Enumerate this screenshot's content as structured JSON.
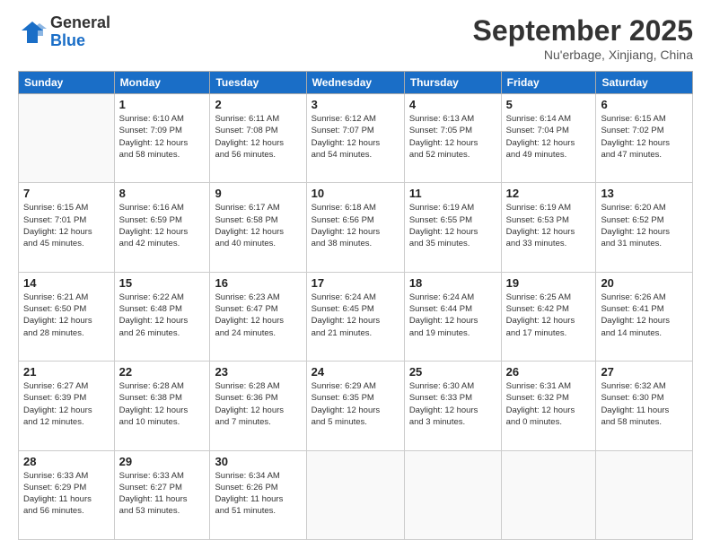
{
  "header": {
    "logo_general": "General",
    "logo_blue": "Blue",
    "month": "September 2025",
    "location": "Nu'erbage, Xinjiang, China"
  },
  "days_of_week": [
    "Sunday",
    "Monday",
    "Tuesday",
    "Wednesday",
    "Thursday",
    "Friday",
    "Saturday"
  ],
  "weeks": [
    [
      {
        "day": "",
        "info": ""
      },
      {
        "day": "1",
        "info": "Sunrise: 6:10 AM\nSunset: 7:09 PM\nDaylight: 12 hours\nand 58 minutes."
      },
      {
        "day": "2",
        "info": "Sunrise: 6:11 AM\nSunset: 7:08 PM\nDaylight: 12 hours\nand 56 minutes."
      },
      {
        "day": "3",
        "info": "Sunrise: 6:12 AM\nSunset: 7:07 PM\nDaylight: 12 hours\nand 54 minutes."
      },
      {
        "day": "4",
        "info": "Sunrise: 6:13 AM\nSunset: 7:05 PM\nDaylight: 12 hours\nand 52 minutes."
      },
      {
        "day": "5",
        "info": "Sunrise: 6:14 AM\nSunset: 7:04 PM\nDaylight: 12 hours\nand 49 minutes."
      },
      {
        "day": "6",
        "info": "Sunrise: 6:15 AM\nSunset: 7:02 PM\nDaylight: 12 hours\nand 47 minutes."
      }
    ],
    [
      {
        "day": "7",
        "info": "Sunrise: 6:15 AM\nSunset: 7:01 PM\nDaylight: 12 hours\nand 45 minutes."
      },
      {
        "day": "8",
        "info": "Sunrise: 6:16 AM\nSunset: 6:59 PM\nDaylight: 12 hours\nand 42 minutes."
      },
      {
        "day": "9",
        "info": "Sunrise: 6:17 AM\nSunset: 6:58 PM\nDaylight: 12 hours\nand 40 minutes."
      },
      {
        "day": "10",
        "info": "Sunrise: 6:18 AM\nSunset: 6:56 PM\nDaylight: 12 hours\nand 38 minutes."
      },
      {
        "day": "11",
        "info": "Sunrise: 6:19 AM\nSunset: 6:55 PM\nDaylight: 12 hours\nand 35 minutes."
      },
      {
        "day": "12",
        "info": "Sunrise: 6:19 AM\nSunset: 6:53 PM\nDaylight: 12 hours\nand 33 minutes."
      },
      {
        "day": "13",
        "info": "Sunrise: 6:20 AM\nSunset: 6:52 PM\nDaylight: 12 hours\nand 31 minutes."
      }
    ],
    [
      {
        "day": "14",
        "info": "Sunrise: 6:21 AM\nSunset: 6:50 PM\nDaylight: 12 hours\nand 28 minutes."
      },
      {
        "day": "15",
        "info": "Sunrise: 6:22 AM\nSunset: 6:48 PM\nDaylight: 12 hours\nand 26 minutes."
      },
      {
        "day": "16",
        "info": "Sunrise: 6:23 AM\nSunset: 6:47 PM\nDaylight: 12 hours\nand 24 minutes."
      },
      {
        "day": "17",
        "info": "Sunrise: 6:24 AM\nSunset: 6:45 PM\nDaylight: 12 hours\nand 21 minutes."
      },
      {
        "day": "18",
        "info": "Sunrise: 6:24 AM\nSunset: 6:44 PM\nDaylight: 12 hours\nand 19 minutes."
      },
      {
        "day": "19",
        "info": "Sunrise: 6:25 AM\nSunset: 6:42 PM\nDaylight: 12 hours\nand 17 minutes."
      },
      {
        "day": "20",
        "info": "Sunrise: 6:26 AM\nSunset: 6:41 PM\nDaylight: 12 hours\nand 14 minutes."
      }
    ],
    [
      {
        "day": "21",
        "info": "Sunrise: 6:27 AM\nSunset: 6:39 PM\nDaylight: 12 hours\nand 12 minutes."
      },
      {
        "day": "22",
        "info": "Sunrise: 6:28 AM\nSunset: 6:38 PM\nDaylight: 12 hours\nand 10 minutes."
      },
      {
        "day": "23",
        "info": "Sunrise: 6:28 AM\nSunset: 6:36 PM\nDaylight: 12 hours\nand 7 minutes."
      },
      {
        "day": "24",
        "info": "Sunrise: 6:29 AM\nSunset: 6:35 PM\nDaylight: 12 hours\nand 5 minutes."
      },
      {
        "day": "25",
        "info": "Sunrise: 6:30 AM\nSunset: 6:33 PM\nDaylight: 12 hours\nand 3 minutes."
      },
      {
        "day": "26",
        "info": "Sunrise: 6:31 AM\nSunset: 6:32 PM\nDaylight: 12 hours\nand 0 minutes."
      },
      {
        "day": "27",
        "info": "Sunrise: 6:32 AM\nSunset: 6:30 PM\nDaylight: 11 hours\nand 58 minutes."
      }
    ],
    [
      {
        "day": "28",
        "info": "Sunrise: 6:33 AM\nSunset: 6:29 PM\nDaylight: 11 hours\nand 56 minutes."
      },
      {
        "day": "29",
        "info": "Sunrise: 6:33 AM\nSunset: 6:27 PM\nDaylight: 11 hours\nand 53 minutes."
      },
      {
        "day": "30",
        "info": "Sunrise: 6:34 AM\nSunset: 6:26 PM\nDaylight: 11 hours\nand 51 minutes."
      },
      {
        "day": "",
        "info": ""
      },
      {
        "day": "",
        "info": ""
      },
      {
        "day": "",
        "info": ""
      },
      {
        "day": "",
        "info": ""
      }
    ]
  ]
}
